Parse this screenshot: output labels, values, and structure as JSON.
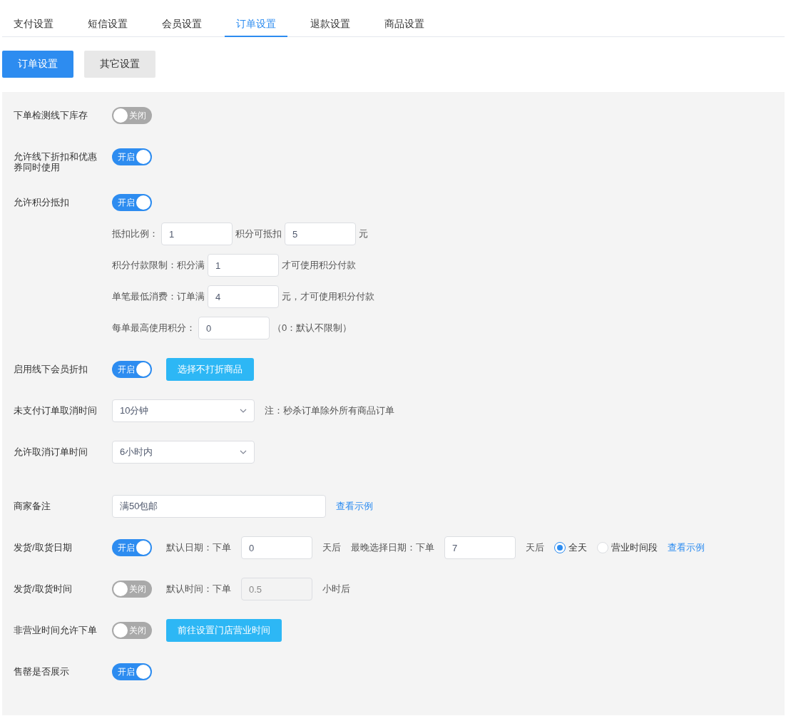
{
  "tabs": [
    {
      "label": "支付设置",
      "selected": false
    },
    {
      "label": "短信设置",
      "selected": false
    },
    {
      "label": "会员设置",
      "selected": false
    },
    {
      "label": "订单设置",
      "selected": true
    },
    {
      "label": "退款设置",
      "selected": false
    },
    {
      "label": "商品设置",
      "selected": false
    }
  ],
  "subtabs": [
    {
      "label": "订单设置",
      "selected": true
    },
    {
      "label": "其它设置",
      "selected": false
    }
  ],
  "rows": [
    {
      "label": "下单检测线下库存",
      "toggle": {
        "on": false,
        "text": "关闭"
      }
    },
    {
      "label": "允许线下折扣和优惠券同时使用",
      "toggle": {
        "on": true,
        "text": "开启"
      }
    },
    {
      "label": "允许积分抵扣",
      "toggle": {
        "on": true,
        "text": "开启"
      },
      "sub_lines": [
        [
          {
            "kind": "text",
            "text": "抵扣比例："
          },
          {
            "kind": "input",
            "value": "1",
            "disabled": false
          },
          {
            "kind": "text",
            "text": "积分可抵扣"
          },
          {
            "kind": "input",
            "value": "5",
            "disabled": false
          },
          {
            "kind": "text",
            "text": "元"
          }
        ],
        [
          {
            "kind": "text",
            "text": "积分付款限制：积分满"
          },
          {
            "kind": "input",
            "value": "1",
            "disabled": false
          },
          {
            "kind": "text",
            "text": "才可使用积分付款"
          }
        ],
        [
          {
            "kind": "text",
            "text": "单笔最低消费：订单满"
          },
          {
            "kind": "input",
            "value": "4",
            "disabled": false
          },
          {
            "kind": "text",
            "text": "元，才可使用积分付款"
          }
        ],
        [
          {
            "kind": "text",
            "text": "每单最高使用积分："
          },
          {
            "kind": "input",
            "value": "0",
            "disabled": false
          },
          {
            "kind": "text",
            "text": "（0：默认不限制）"
          }
        ]
      ]
    },
    {
      "label": "启用线下会员折扣",
      "toggle": {
        "on": true,
        "text": "开启"
      },
      "items": [
        {
          "kind": "button",
          "text": "选择不打折商品"
        }
      ]
    },
    {
      "label": "未支付订单取消时间",
      "items": [
        {
          "kind": "select",
          "value": "10分钟"
        },
        {
          "kind": "text",
          "text": "注：秒杀订单除外所有商品订单"
        }
      ]
    },
    {
      "label": "允许取消订单时间",
      "items": [
        {
          "kind": "select",
          "value": "6小时内"
        }
      ]
    },
    {
      "label": "商家备注",
      "items": [
        {
          "kind": "wide_input",
          "value": "满50包邮",
          "disabled": false
        },
        {
          "kind": "link",
          "text": "查看示例"
        }
      ]
    },
    {
      "label": "发货/取货日期",
      "toggle": {
        "on": true,
        "text": "开启"
      },
      "items": [
        {
          "kind": "text",
          "text": "默认日期：下单"
        },
        {
          "kind": "input",
          "value": "0",
          "disabled": false
        },
        {
          "kind": "text",
          "text": "天后"
        },
        {
          "kind": "text",
          "text": "最晚选择日期：下单"
        },
        {
          "kind": "input",
          "value": "7",
          "disabled": false
        },
        {
          "kind": "text",
          "text": "天后"
        },
        {
          "kind": "radio",
          "text": "全天",
          "selected": true
        },
        {
          "kind": "radio",
          "text": "营业时间段",
          "selected": false
        },
        {
          "kind": "link",
          "text": "查看示例"
        }
      ]
    },
    {
      "label": "发货/取货时间",
      "toggle": {
        "on": false,
        "text": "关闭"
      },
      "items": [
        {
          "kind": "text",
          "text": "默认时间：下单"
        },
        {
          "kind": "input",
          "value": "0.5",
          "disabled": true
        },
        {
          "kind": "text",
          "text": "小时后"
        }
      ]
    },
    {
      "label": "非营业时间允许下单",
      "toggle": {
        "on": false,
        "text": "关闭"
      },
      "items": [
        {
          "kind": "button",
          "text": "前往设置门店营业时间"
        }
      ]
    },
    {
      "label": "售罄是否展示",
      "toggle": {
        "on": true,
        "text": "开启"
      }
    }
  ]
}
